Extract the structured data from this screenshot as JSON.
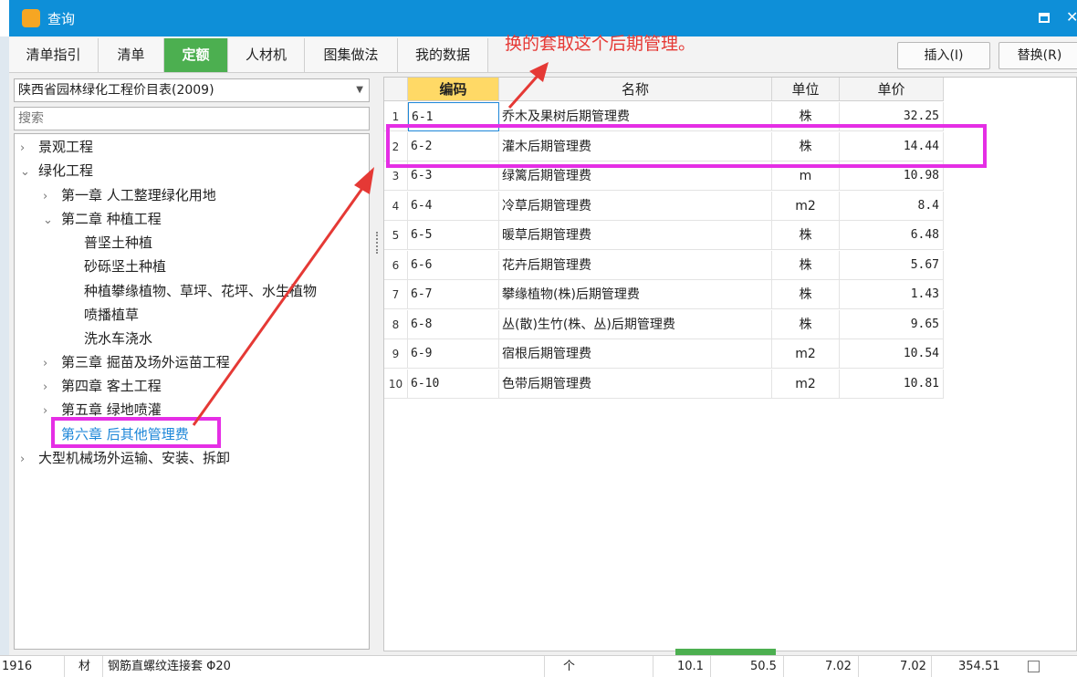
{
  "window": {
    "title": "查询",
    "close_glyph": "✕"
  },
  "tabs": [
    {
      "label": "清单指引",
      "active": false
    },
    {
      "label": "清单",
      "active": false
    },
    {
      "label": "定额",
      "active": true
    },
    {
      "label": "人材机",
      "active": false
    },
    {
      "label": "图集做法",
      "active": false
    },
    {
      "label": "我的数据",
      "active": false
    }
  ],
  "buttons": {
    "insert_label": "插入(I)",
    "replace_label": "替换(R)"
  },
  "library": {
    "selected": "陕西省园林绿化工程价目表(2009)"
  },
  "search": {
    "placeholder": "搜索"
  },
  "tree": [
    {
      "label": "景观工程",
      "arrow": "›",
      "selected": false
    },
    {
      "label": "绿化工程",
      "arrow": "⌄",
      "selected": false
    },
    {
      "label": "第一章 人工整理绿化用地",
      "arrow": "›",
      "selected": false
    },
    {
      "label": "第二章 种植工程",
      "arrow": "⌄",
      "selected": false
    },
    {
      "label": "普坚土种植",
      "arrow": "",
      "selected": false
    },
    {
      "label": "砂砾坚土种植",
      "arrow": "",
      "selected": false
    },
    {
      "label": "种植攀缘植物、草坪、花坪、水生植物",
      "arrow": "",
      "selected": false
    },
    {
      "label": "喷播植草",
      "arrow": "",
      "selected": false
    },
    {
      "label": "洗水车浇水",
      "arrow": "",
      "selected": false
    },
    {
      "label": "第三章 掘苗及场外运苗工程",
      "arrow": "›",
      "selected": false
    },
    {
      "label": "第四章 客土工程",
      "arrow": "›",
      "selected": false
    },
    {
      "label": "第五章 绿地喷灌",
      "arrow": "›",
      "selected": false
    },
    {
      "label": "第六章 后其他管理费",
      "arrow": "",
      "selected": true
    },
    {
      "label": "大型机械场外运输、安装、拆卸",
      "arrow": "›",
      "selected": false
    }
  ],
  "grid": {
    "headers": {
      "code": "编码",
      "name": "名称",
      "unit": "单位",
      "price": "单价"
    },
    "rows": [
      {
        "no": "1",
        "code": "6-1",
        "name": "乔木及果树后期管理费",
        "unit": "株",
        "price": "32.25"
      },
      {
        "no": "2",
        "code": "6-2",
        "name": "灌木后期管理费",
        "unit": "株",
        "price": "14.44"
      },
      {
        "no": "3",
        "code": "6-3",
        "name": "绿篱后期管理费",
        "unit": "m",
        "price": "10.98"
      },
      {
        "no": "4",
        "code": "6-4",
        "name": "冷草后期管理费",
        "unit": "m2",
        "price": "8.4"
      },
      {
        "no": "5",
        "code": "6-5",
        "name": "暖草后期管理费",
        "unit": "株",
        "price": "6.48"
      },
      {
        "no": "6",
        "code": "6-6",
        "name": "花卉后期管理费",
        "unit": "株",
        "price": "5.67"
      },
      {
        "no": "7",
        "code": "6-7",
        "name": "攀缘植物(株)后期管理费",
        "unit": "株",
        "price": "1.43"
      },
      {
        "no": "8",
        "code": "6-8",
        "name": "丛(散)生竹(株、丛)后期管理费",
        "unit": "株",
        "price": "9.65"
      },
      {
        "no": "9",
        "code": "6-9",
        "name": "宿根后期管理费",
        "unit": "m2",
        "price": "10.54"
      },
      {
        "no": "10",
        "code": "6-10",
        "name": "色带后期管理费",
        "unit": "m2",
        "price": "10.81"
      }
    ]
  },
  "annotation": {
    "text": "换的套取这个后期管理。"
  },
  "bottom_row": {
    "code": "1916",
    "type": "材",
    "name": "钢筋直螺纹连接套 Φ20",
    "unit": "个",
    "v1": "10.1",
    "v2": "50.5",
    "v3": "7.02",
    "v4": "7.02",
    "v5": "354.51"
  },
  "colors": {
    "title_bar": "#0e8fd8",
    "active_tab": "#4caf50",
    "annotation": "#e52ee5",
    "arrow": "#e53935",
    "selected_node": "#1c86d8"
  }
}
